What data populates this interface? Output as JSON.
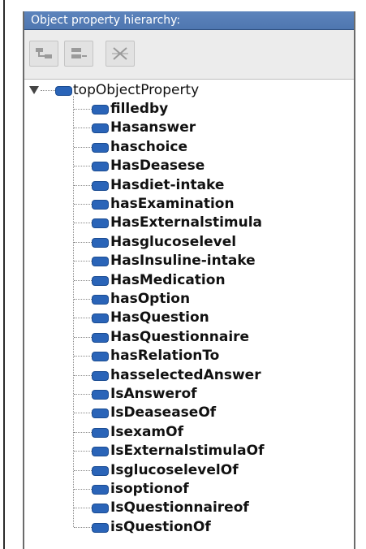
{
  "panel": {
    "title": "Object property hierarchy:"
  },
  "toolbar": {
    "buttons": [
      {
        "icon": "add-sub-property-icon"
      },
      {
        "icon": "add-sibling-property-icon"
      },
      {
        "icon": "delete-property-icon"
      }
    ]
  },
  "tree": {
    "root": {
      "label": "topObjectProperty",
      "expanded": true
    },
    "children": [
      {
        "label": "filledby"
      },
      {
        "label": "Hasanswer"
      },
      {
        "label": "haschoice"
      },
      {
        "label": "HasDeasese"
      },
      {
        "label": "Hasdiet-intake"
      },
      {
        "label": "hasExamination"
      },
      {
        "label": "HasExternalstimula"
      },
      {
        "label": "Hasglucoselevel"
      },
      {
        "label": "HasInsuline-intake"
      },
      {
        "label": "HasMedication"
      },
      {
        "label": "hasOption"
      },
      {
        "label": "HasQuestion"
      },
      {
        "label": "HasQuestionnaire"
      },
      {
        "label": "hasRelationTo"
      },
      {
        "label": "hasselectedAnswer"
      },
      {
        "label": "IsAnswerof"
      },
      {
        "label": "IsDeaseaseOf"
      },
      {
        "label": "IsexamOf"
      },
      {
        "label": "IsExternalstimulaOf"
      },
      {
        "label": "IsglucoselevelOf"
      },
      {
        "label": "isoptionof"
      },
      {
        "label": "IsQuestionnaireof"
      },
      {
        "label": "isQuestionOf"
      }
    ]
  },
  "colors": {
    "title_bar": "#5d84bc",
    "property_icon": "#2a64b8"
  }
}
